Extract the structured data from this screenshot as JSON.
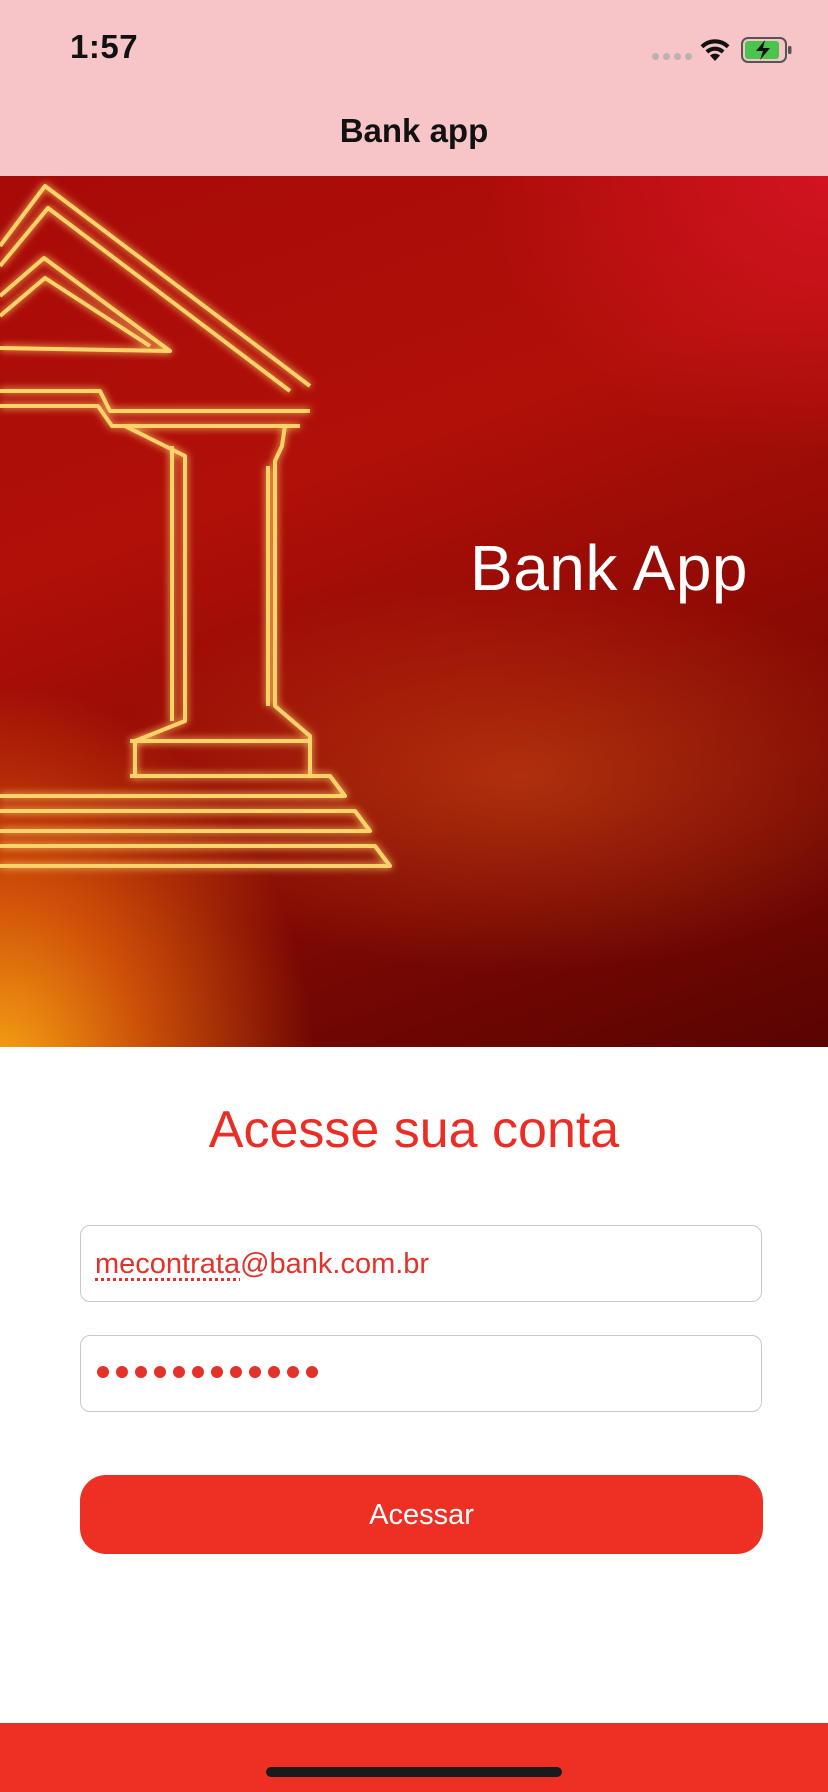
{
  "status_bar": {
    "time": "1:57",
    "icons": [
      "signal-dots-icon",
      "wifi-icon",
      "battery-charging-icon"
    ]
  },
  "nav": {
    "title": "Bank app"
  },
  "hero": {
    "title": "Bank App",
    "icon": "bank-building-icon"
  },
  "form": {
    "title": "Acesse sua conta",
    "email": {
      "value_part1": "mecontrata",
      "value_part2": "@bank.com.br"
    },
    "password": {
      "masked_length": 12
    },
    "submit_label": "Acessar"
  },
  "colors": {
    "accent": "#ee2f24",
    "nav_background": "#f7c5c7",
    "text_on_accent": "#ffffff"
  }
}
